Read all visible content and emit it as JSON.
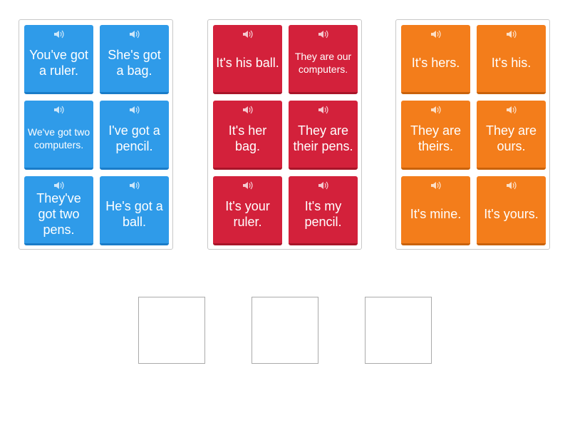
{
  "stacks": [
    {
      "color": "#2f9be9",
      "cards": [
        {
          "text": "You've got a ruler."
        },
        {
          "text": "She's got a bag."
        },
        {
          "text": "We've got two computers."
        },
        {
          "text": "I've got a pencil."
        },
        {
          "text": "They've got two pens."
        },
        {
          "text": "He's got a ball."
        }
      ]
    },
    {
      "color": "#d3213b",
      "cards": [
        {
          "text": "It's his ball."
        },
        {
          "text": "They are our computers."
        },
        {
          "text": "It's her bag."
        },
        {
          "text": "They are their pens."
        },
        {
          "text": "It's your ruler."
        },
        {
          "text": "It's my pencil."
        }
      ]
    },
    {
      "color": "#f37d1b",
      "cards": [
        {
          "text": "It's hers."
        },
        {
          "text": "It's his."
        },
        {
          "text": "They are theirs."
        },
        {
          "text": "They are ours."
        },
        {
          "text": "It's mine."
        },
        {
          "text": "It's yours."
        }
      ]
    }
  ],
  "speaker_icon": "speaker-icon",
  "drop_slots": 3
}
